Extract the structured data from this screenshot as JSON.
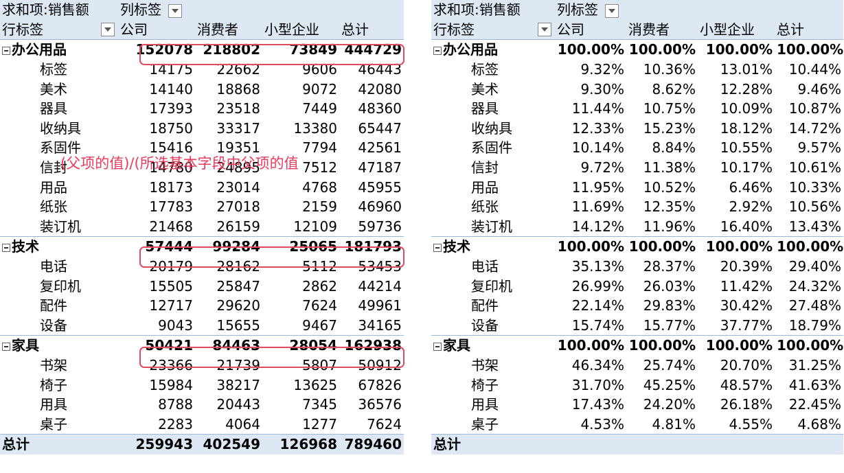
{
  "left": {
    "header1": {
      "measure": "求和项:销售额",
      "col_label": "列标签"
    },
    "header2": {
      "row_label": "行标签",
      "cols": [
        "公司",
        "消费者",
        "小型企业",
        "总计"
      ]
    },
    "groups": [
      {
        "name": "办公用品",
        "values": [
          "152078",
          "218802",
          "73849",
          "444729"
        ],
        "items": [
          {
            "name": "标签",
            "values": [
              "14175",
              "22662",
              "9606",
              "46443"
            ]
          },
          {
            "name": "美术",
            "values": [
              "14140",
              "18868",
              "9072",
              "42080"
            ]
          },
          {
            "name": "器具",
            "values": [
              "17393",
              "23518",
              "7449",
              "48360"
            ]
          },
          {
            "name": "收纳具",
            "values": [
              "18750",
              "33317",
              "13380",
              "65447"
            ]
          },
          {
            "name": "系固件",
            "values": [
              "15416",
              "19351",
              "7794",
              "42561"
            ]
          },
          {
            "name": "信封",
            "values": [
              "14780",
              "24895",
              "7512",
              "47187"
            ]
          },
          {
            "name": "用品",
            "values": [
              "18173",
              "23014",
              "4768",
              "45955"
            ]
          },
          {
            "name": "纸张",
            "values": [
              "17783",
              "27018",
              "2159",
              "46960"
            ]
          },
          {
            "name": "装订机",
            "values": [
              "21468",
              "26159",
              "12109",
              "59736"
            ]
          }
        ]
      },
      {
        "name": "技术",
        "values": [
          "57444",
          "99284",
          "25065",
          "181793"
        ],
        "items": [
          {
            "name": "电话",
            "values": [
              "20179",
              "28162",
              "5112",
              "53453"
            ]
          },
          {
            "name": "复印机",
            "values": [
              "15505",
              "25847",
              "2862",
              "44214"
            ]
          },
          {
            "name": "配件",
            "values": [
              "12717",
              "29620",
              "7624",
              "49961"
            ]
          },
          {
            "name": "设备",
            "values": [
              "9043",
              "15655",
              "9467",
              "34165"
            ]
          }
        ]
      },
      {
        "name": "家具",
        "values": [
          "50421",
          "84463",
          "28054",
          "162938"
        ],
        "items": [
          {
            "name": "书架",
            "values": [
              "23366",
              "21739",
              "5807",
              "50912"
            ]
          },
          {
            "name": "椅子",
            "values": [
              "15984",
              "38217",
              "13625",
              "67826"
            ]
          },
          {
            "name": "用具",
            "values": [
              "8788",
              "20443",
              "7345",
              "36576"
            ]
          },
          {
            "name": "桌子",
            "values": [
              "2283",
              "4064",
              "1277",
              "7624"
            ]
          }
        ]
      }
    ],
    "total": {
      "label": "总计",
      "values": [
        "259943",
        "402549",
        "126968",
        "789460"
      ]
    },
    "overlay_text": "(父项的值)/(所选基本字段中父项的值"
  },
  "right": {
    "header1": {
      "measure": "求和项:销售额",
      "col_label": "列标签"
    },
    "header2": {
      "row_label": "行标签",
      "cols": [
        "公司",
        "消费者",
        "小型企业",
        "总计"
      ]
    },
    "groups": [
      {
        "name": "办公用品",
        "values": [
          "100.00%",
          "100.00%",
          "100.00%",
          "100.00%"
        ],
        "items": [
          {
            "name": "标签",
            "values": [
              "9.32%",
              "10.36%",
              "13.01%",
              "10.44%"
            ]
          },
          {
            "name": "美术",
            "values": [
              "9.30%",
              "8.62%",
              "12.28%",
              "9.46%"
            ]
          },
          {
            "name": "器具",
            "values": [
              "11.44%",
              "10.75%",
              "10.09%",
              "10.87%"
            ]
          },
          {
            "name": "收纳具",
            "values": [
              "12.33%",
              "15.23%",
              "18.12%",
              "14.72%"
            ]
          },
          {
            "name": "系固件",
            "values": [
              "10.14%",
              "8.84%",
              "10.55%",
              "9.57%"
            ]
          },
          {
            "name": "信封",
            "values": [
              "9.72%",
              "11.38%",
              "10.17%",
              "10.61%"
            ]
          },
          {
            "name": "用品",
            "values": [
              "11.95%",
              "10.52%",
              "6.46%",
              "10.33%"
            ]
          },
          {
            "name": "纸张",
            "values": [
              "11.69%",
              "12.35%",
              "2.92%",
              "10.56%"
            ]
          },
          {
            "name": "装订机",
            "values": [
              "14.12%",
              "11.96%",
              "16.40%",
              "13.43%"
            ]
          }
        ]
      },
      {
        "name": "技术",
        "values": [
          "100.00%",
          "100.00%",
          "100.00%",
          "100.00%"
        ],
        "items": [
          {
            "name": "电话",
            "values": [
              "35.13%",
              "28.37%",
              "20.39%",
              "29.40%"
            ]
          },
          {
            "name": "复印机",
            "values": [
              "26.99%",
              "26.03%",
              "11.42%",
              "24.32%"
            ]
          },
          {
            "name": "配件",
            "values": [
              "22.14%",
              "29.83%",
              "30.42%",
              "27.48%"
            ]
          },
          {
            "name": "设备",
            "values": [
              "15.74%",
              "15.77%",
              "37.77%",
              "18.79%"
            ]
          }
        ]
      },
      {
        "name": "家具",
        "values": [
          "100.00%",
          "100.00%",
          "100.00%",
          "100.00%"
        ],
        "items": [
          {
            "name": "书架",
            "values": [
              "46.34%",
              "25.74%",
              "20.70%",
              "31.25%"
            ]
          },
          {
            "name": "椅子",
            "values": [
              "31.70%",
              "45.25%",
              "48.57%",
              "41.63%"
            ]
          },
          {
            "name": "用具",
            "values": [
              "17.43%",
              "24.20%",
              "26.18%",
              "22.45%"
            ]
          },
          {
            "name": "桌子",
            "values": [
              "4.53%",
              "4.81%",
              "4.55%",
              "4.68%"
            ]
          }
        ]
      }
    ],
    "total": {
      "label": "总计",
      "values": [
        "",
        "",
        "",
        ""
      ]
    }
  },
  "colors": {
    "header_bg": "#dde8f4",
    "border": "#9bb7d9",
    "highlight": "#e04a5f",
    "overlay_text": "#ee3a5a"
  },
  "icons": {
    "filter": "dropdown-arrow-icon",
    "collapse": "collapse-minus-icon"
  }
}
